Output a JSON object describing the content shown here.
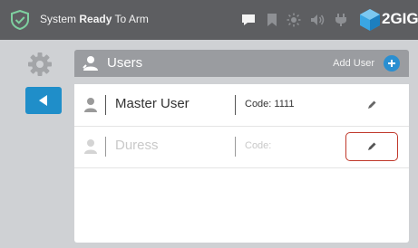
{
  "status_bar": {
    "prefix": "System",
    "state": "Ready",
    "suffix": "To Arm",
    "icons": [
      "shield-check-icon",
      "message-icon",
      "bookmark-icon",
      "brightness-icon",
      "volume-icon",
      "power-plug-icon"
    ],
    "logo": "2GIG"
  },
  "nav": {
    "settings_icon": "gear-icon",
    "back_icon": "back-arrow-icon"
  },
  "users_panel": {
    "title": "Users",
    "add_user_label": "Add User",
    "rows": [
      {
        "name": "Master User",
        "code": "Code: 1111"
      },
      {
        "name": "Duress",
        "code": "Code:"
      }
    ]
  },
  "colors": {
    "topbar": "#5d5e61",
    "accent": "#1f8ec9",
    "header": "#9a9ca0",
    "shield": "#7ed0a0",
    "highlight_border": "#c0392b"
  }
}
